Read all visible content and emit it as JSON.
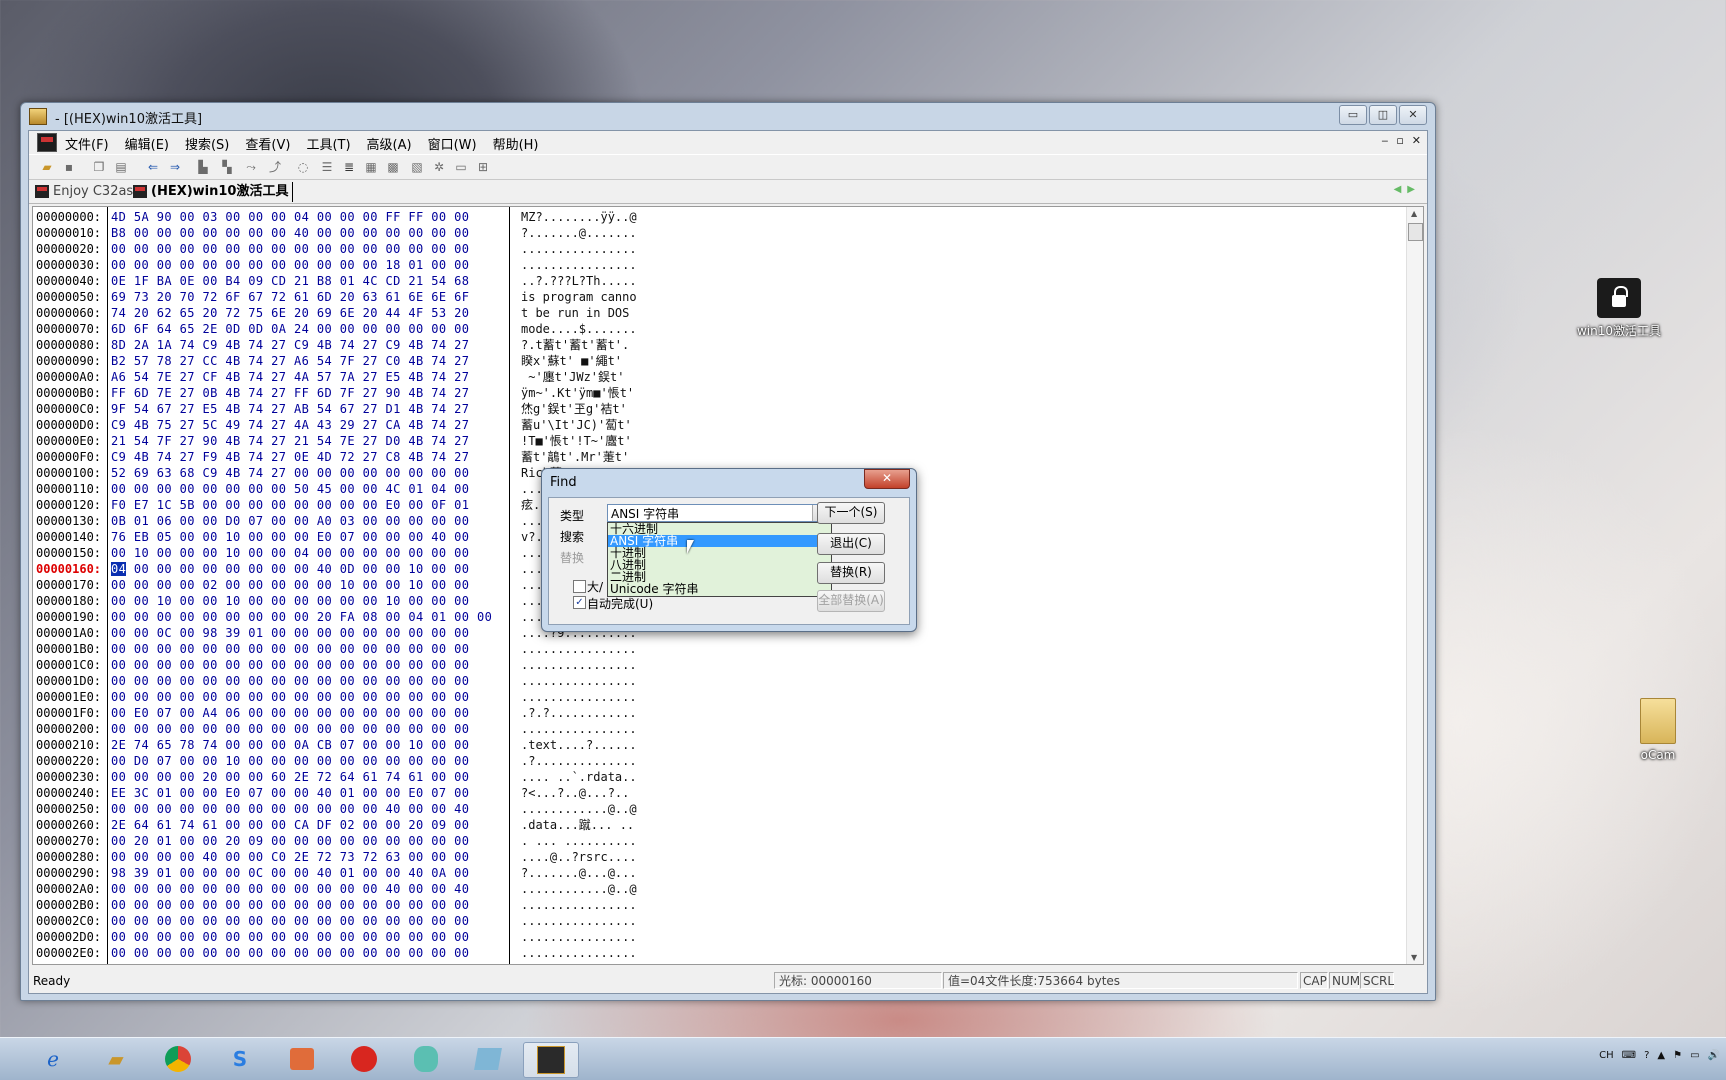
{
  "window": {
    "title": "- [(HEX)win10激活工具]",
    "controls": [
      "▭",
      "◫",
      "✕"
    ]
  },
  "menubar": {
    "items": [
      "文件(F)",
      "编辑(E)",
      "搜索(S)",
      "查看(V)",
      "工具(T)",
      "高级(A)",
      "窗口(W)",
      "帮助(H)"
    ],
    "mdi_controls": [
      "‒",
      "▫",
      "✕"
    ]
  },
  "toolbar": {
    "icons": [
      "open-folder-icon",
      "save-icon",
      "copy-icon",
      "paste-icon",
      "back-arrow-icon",
      "forward-arrow-icon",
      "tool-1-icon",
      "tool-2-icon",
      "tool-3-icon",
      "tool-4-icon",
      "tool-5-icon",
      "tool-6-icon",
      "tool-7-icon",
      "tool-8-icon",
      "tool-9-icon",
      "tool-10-icon",
      "tool-11-icon",
      "tool-12-icon"
    ]
  },
  "tabs": [
    {
      "label": "Enjoy C32asm",
      "active": false
    },
    {
      "label": "(HEX)win10激活工具",
      "active": true
    }
  ],
  "hex_view": {
    "current_address": "00000160:",
    "rows": [
      {
        "addr": "00000000:",
        "hex": "4D 5A 90 00 03 00 00 00 04 00 00 00 FF FF 00 00",
        "ascii": "MZ?........ÿÿ..@"
      },
      {
        "addr": "00000010:",
        "hex": "B8 00 00 00 00 00 00 00 40 00 00 00 00 00 00 00",
        "ascii": "?.......@......."
      },
      {
        "addr": "00000020:",
        "hex": "00 00 00 00 00 00 00 00 00 00 00 00 00 00 00 00",
        "ascii": "................"
      },
      {
        "addr": "00000030:",
        "hex": "00 00 00 00 00 00 00 00 00 00 00 00 18 01 00 00",
        "ascii": "................"
      },
      {
        "addr": "00000040:",
        "hex": "0E 1F BA 0E 00 B4 09 CD 21 B8 01 4C CD 21 54 68",
        "ascii": "..?.???L?Th....."
      },
      {
        "addr": "00000050:",
        "hex": "69 73 20 70 72 6F 67 72 61 6D 20 63 61 6E 6E 6F",
        "ascii": "is program canno"
      },
      {
        "addr": "00000060:",
        "hex": "74 20 62 65 20 72 75 6E 20 69 6E 20 44 4F 53 20",
        "ascii": "t be run in DOS "
      },
      {
        "addr": "00000070:",
        "hex": "6D 6F 64 65 2E 0D 0D 0A 24 00 00 00 00 00 00 00",
        "ascii": "mode....$......."
      },
      {
        "addr": "00000080:",
        "hex": "8D 2A 1A 74 C9 4B 74 27 C9 4B 74 27 C9 4B 74 27",
        "ascii": "?.t蓄t'蓄t'蓄t'."
      },
      {
        "addr": "00000090:",
        "hex": "B2 57 78 27 CC 4B 74 27 A6 54 7F 27 C0 4B 74 27",
        "ascii": "睽x'蘇t' ■'繩t'"
      },
      {
        "addr": "000000A0:",
        "hex": "A6 54 7E 27 CF 4B 74 27 4A 57 7A 27 E5 4B 74 27",
        "ascii": " ~'廛t'JWz'鋘t'"
      },
      {
        "addr": "000000B0:",
        "hex": "FF 6D 7E 27 0B 4B 74 27 FF 6D 7F 27 90 4B 74 27",
        "ascii": "ÿm~'.Kt'ÿm■'悵t'"
      },
      {
        "addr": "000000C0:",
        "hex": "9F 54 67 27 E5 4B 74 27 AB 54 67 27 D1 4B 74 27",
        "ascii": "烋g'鋘t'玊g'袺t'"
      },
      {
        "addr": "000000D0:",
        "hex": "C9 4B 75 27 5C 49 74 27 4A 43 29 27 CA 4B 74 27",
        "ascii": "蓄u'\\It'JC)'蔔t'"
      },
      {
        "addr": "000000E0:",
        "hex": "21 54 7F 27 90 4B 74 27 21 54 7E 27 D0 4B 74 27",
        "ascii": "!T■'悵t'!T~'蠯t'"
      },
      {
        "addr": "000000F0:",
        "hex": "C9 4B 74 27 F9 4B 74 27 0E 4D 72 27 C8 4B 74 27",
        "ascii": "蓄t'鶮t'.Mr'萐t'"
      },
      {
        "addr": "00000100:",
        "hex": "52 69 63 68 C9 4B 74 27 00 00 00 00 00 00 00 00",
        "ascii": "Rich蓄t'........"
      },
      {
        "addr": "00000110:",
        "hex": "00 00 00 00 00 00 00 00 50 45 00 00 4C 01 04 00",
        "ascii": "........PE..L..."
      },
      {
        "addr": "00000120:",
        "hex": "F0 E7 1C 5B 00 00 00 00 00 00 00 00 E0 00 0F 01",
        "ascii": "痃.[........?..."
      },
      {
        "addr": "00000130:",
        "hex": "0B 01 06 00 00 D0 07 00 00 A0 03 00 00 00 00 00",
        "ascii": "....?..?......."
      },
      {
        "addr": "00000140:",
        "hex": "76 EB 05 00 00 10 00 00 00 E0 07 00 00 00 40 00",
        "ascii": "v?......?...@."
      },
      {
        "addr": "00000150:",
        "hex": "00 10 00 00 00 10 00 00 04 00 00 00 00 00 00 00",
        "ascii": "................"
      },
      {
        "addr": "00000160:",
        "hex": "04 00 00 00 00 00 00 00 00 40 0D 00 00 10 00 00",
        "ascii": "........@......."
      },
      {
        "addr": "00000170:",
        "hex": "00 00 00 00 02 00 00 00 00 00 10 00 00 10 00 00",
        "ascii": "................"
      },
      {
        "addr": "00000180:",
        "hex": "00 00 10 00 00 10 00 00 00 00 00 00 10 00 00 00",
        "ascii": "................"
      },
      {
        "addr": "00000190:",
        "hex": "00 00 00 00 00 00 00 00 00 20 FA 08 00 04 01 00 00",
        "ascii": "......... ?....."
      },
      {
        "addr": "000001A0:",
        "hex": "00 00 0C 00 98 39 01 00 00 00 00 00 00 00 00 00",
        "ascii": "....?9.........."
      },
      {
        "addr": "000001B0:",
        "hex": "00 00 00 00 00 00 00 00 00 00 00 00 00 00 00 00",
        "ascii": "................"
      },
      {
        "addr": "000001C0:",
        "hex": "00 00 00 00 00 00 00 00 00 00 00 00 00 00 00 00",
        "ascii": "................"
      },
      {
        "addr": "000001D0:",
        "hex": "00 00 00 00 00 00 00 00 00 00 00 00 00 00 00 00",
        "ascii": "................"
      },
      {
        "addr": "000001E0:",
        "hex": "00 00 00 00 00 00 00 00 00 00 00 00 00 00 00 00",
        "ascii": "................"
      },
      {
        "addr": "000001F0:",
        "hex": "00 E0 07 00 A4 06 00 00 00 00 00 00 00 00 00 00",
        "ascii": ".?.?............"
      },
      {
        "addr": "00000200:",
        "hex": "00 00 00 00 00 00 00 00 00 00 00 00 00 00 00 00",
        "ascii": "................"
      },
      {
        "addr": "00000210:",
        "hex": "2E 74 65 78 74 00 00 00 0A CB 07 00 00 10 00 00",
        "ascii": ".text....?......"
      },
      {
        "addr": "00000220:",
        "hex": "00 D0 07 00 00 10 00 00 00 00 00 00 00 00 00 00",
        "ascii": ".?.............."
      },
      {
        "addr": "00000230:",
        "hex": "00 00 00 00 20 00 00 60 2E 72 64 61 74 61 00 00",
        "ascii": ".... ..`.rdata.."
      },
      {
        "addr": "00000240:",
        "hex": "EE 3C 01 00 00 E0 07 00 00 40 01 00 00 E0 07 00",
        "ascii": "?<...?..@...?.."
      },
      {
        "addr": "00000250:",
        "hex": "00 00 00 00 00 00 00 00 00 00 00 00 40 00 00 40",
        "ascii": "............@..@"
      },
      {
        "addr": "00000260:",
        "hex": "2E 64 61 74 61 00 00 00 CA DF 02 00 00 20 09 00",
        "ascii": ".data...蹴... .."
      },
      {
        "addr": "00000270:",
        "hex": "00 20 01 00 00 20 09 00 00 00 00 00 00 00 00 00",
        "ascii": ". ... .........."
      },
      {
        "addr": "00000280:",
        "hex": "00 00 00 00 40 00 00 C0 2E 72 73 72 63 00 00 00",
        "ascii": "....@..?rsrc...."
      },
      {
        "addr": "00000290:",
        "hex": "98 39 01 00 00 00 0C 00 00 40 01 00 00 40 0A 00",
        "ascii": "?.......@...@..."
      },
      {
        "addr": "000002A0:",
        "hex": "00 00 00 00 00 00 00 00 00 00 00 00 40 00 00 40",
        "ascii": "............@..@"
      },
      {
        "addr": "000002B0:",
        "hex": "00 00 00 00 00 00 00 00 00 00 00 00 00 00 00 00",
        "ascii": "................"
      },
      {
        "addr": "000002C0:",
        "hex": "00 00 00 00 00 00 00 00 00 00 00 00 00 00 00 00",
        "ascii": "................"
      },
      {
        "addr": "000002D0:",
        "hex": "00 00 00 00 00 00 00 00 00 00 00 00 00 00 00 00",
        "ascii": "................"
      },
      {
        "addr": "000002E0:",
        "hex": "00 00 00 00 00 00 00 00 00 00 00 00 00 00 00 00",
        "ascii": "................"
      }
    ]
  },
  "statusbar": {
    "ready": "Ready",
    "cursor": "光标: 00000160",
    "value_length": "值=04文件长度:753664 bytes",
    "cap": "CAP",
    "num": "NUM",
    "scrl": "SCRL"
  },
  "find_dialog": {
    "title": "Find",
    "close": "✕",
    "type_label": "类型",
    "search_label": "搜索",
    "replace_label": "替换",
    "type_value": "ANSI 字符串",
    "options": [
      "十六进制",
      "ANSI 字符串",
      "十进制",
      "八进制",
      "二进制",
      "Unicode 字符串"
    ],
    "selected_option": "ANSI 字符串",
    "next_button": "下一个(S)",
    "exit_button": "退出(C)",
    "replace_button": "替换(R)",
    "replace_all_button": "全部替换(A)",
    "case_label": "大/",
    "autocomplete_label": "自动完成(U)",
    "autocomplete_checked": true
  },
  "desktop": {
    "icons": [
      {
        "label": "win10激活工具",
        "icon": "lock-monitor-icon"
      },
      {
        "label": "oCam",
        "icon": "folder-icon"
      }
    ]
  },
  "taskbar": {
    "apps": [
      "internet-explorer-icon",
      "file-explorer-icon",
      "chrome-icon",
      "sogou-icon",
      "image-viewer-icon",
      "netease-music-icon",
      "anime-app-icon",
      "notebook-icon",
      "c32asm-icon"
    ],
    "tray": [
      "CH",
      "⌨",
      "?",
      "▲",
      "⚑",
      "▭",
      "🔊"
    ]
  },
  "colors": {
    "hex_text": "#00009a",
    "current_address": "#dd0000",
    "selection": "#3399ff",
    "dropdown_bg": "#e1f2da"
  }
}
